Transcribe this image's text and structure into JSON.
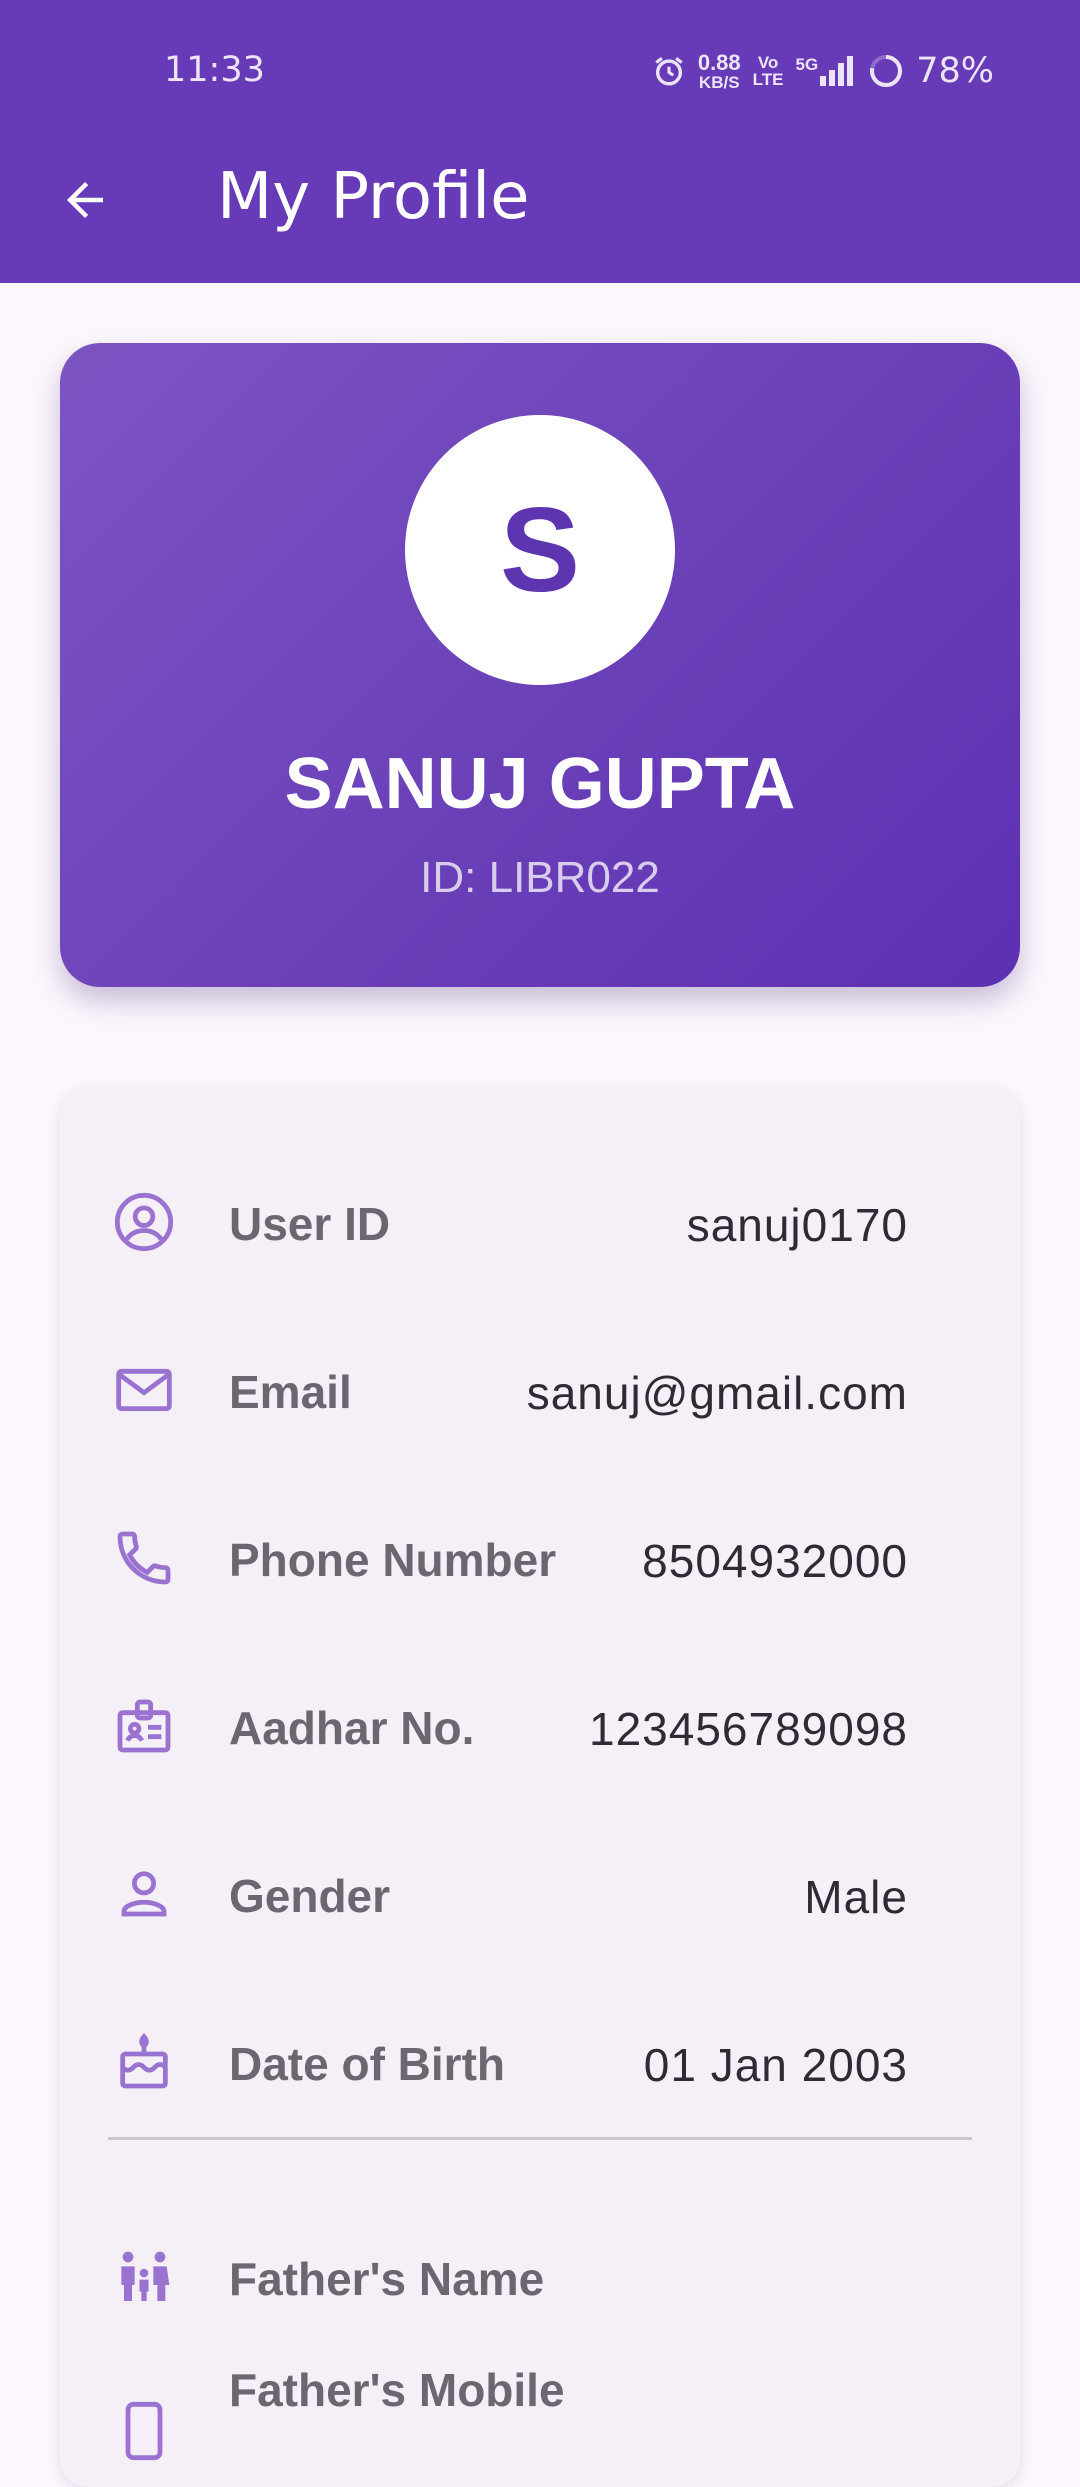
{
  "status": {
    "time": "11:33",
    "net_speed_value": "0.88",
    "net_speed_unit": "KB/S",
    "volte_top": "Vo",
    "volte_bottom": "LTE",
    "network": "5G",
    "battery": "78%"
  },
  "appbar": {
    "title": "My Profile"
  },
  "profile": {
    "initial": "S",
    "name": "SANUJ GUPTA",
    "id_line": "ID: LIBR022"
  },
  "details": [
    {
      "icon": "account-circle-icon",
      "label": "User ID",
      "value": "sanuj0170"
    },
    {
      "icon": "email-icon",
      "label": "Email",
      "value": "sanuj@gmail.com"
    },
    {
      "icon": "phone-icon",
      "label": "Phone Number",
      "value": "8504932000"
    },
    {
      "icon": "badge-icon",
      "label": "Aadhar No.",
      "value": "123456789098"
    },
    {
      "icon": "person-icon",
      "label": "Gender",
      "value": "Male"
    },
    {
      "icon": "cake-icon",
      "label": "Date of Birth",
      "value": "01 Jan 2003"
    }
  ],
  "family": [
    {
      "icon": "family-icon",
      "label": "Father's Name",
      "value": ""
    },
    {
      "icon": "phone-icon",
      "label": "Father's Mobile",
      "value": ""
    }
  ],
  "colors": {
    "primary": "#673ab7",
    "icon": "#9a72d0",
    "background": "#fcf7fd"
  }
}
